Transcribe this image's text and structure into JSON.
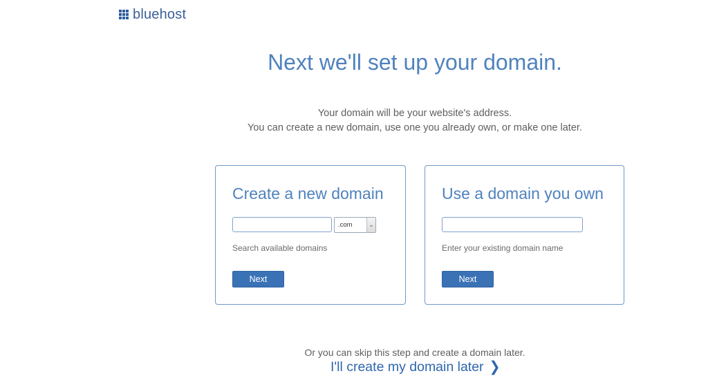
{
  "header": {
    "logo_icon": "bluehost-grid-icon",
    "logo_text": "bluehost"
  },
  "main": {
    "headline": "Next we'll set up your domain.",
    "subtext_line1": "Your domain will be your website's address.",
    "subtext_line2": "You can create a new domain, use one you already own, or make one later."
  },
  "new_domain_card": {
    "title": "Create a new domain",
    "input_value": "",
    "tld_selected": ".com",
    "hint": "Search available domains",
    "button_label": "Next"
  },
  "own_domain_card": {
    "title": "Use a domain you own",
    "input_value": "",
    "hint": "Enter your existing domain name",
    "button_label": "Next"
  },
  "footer": {
    "skip_text": "Or you can skip this step and create a domain later.",
    "later_link": "I'll create my domain later",
    "later_icon": "chevron-right-icon"
  },
  "colors": {
    "brand_blue": "#3b72b6",
    "heading_blue": "#4f82bd",
    "link_blue": "#2f67ad",
    "card_border": "#6e9acc"
  }
}
